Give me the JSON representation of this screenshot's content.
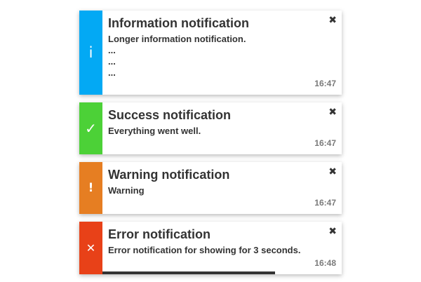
{
  "notifications": [
    {
      "type": "info",
      "color": "#03a9f4",
      "icon": "info-icon",
      "glyph": "i",
      "title": "Information notification",
      "message_lines": [
        "Longer information notification.",
        "...",
        "...",
        "..."
      ],
      "time": "16:47",
      "close_glyph": "✖"
    },
    {
      "type": "success",
      "color": "#4cd137",
      "icon": "checkmark-icon",
      "glyph": "✓",
      "title": "Success notification",
      "message_lines": [
        "Everything went well."
      ],
      "time": "16:47",
      "close_glyph": "✖"
    },
    {
      "type": "warning",
      "color": "#e67e22",
      "icon": "exclamation-icon",
      "glyph": "!",
      "title": "Warning notification",
      "message_lines": [
        "Warning"
      ],
      "time": "16:47",
      "close_glyph": "✖"
    },
    {
      "type": "error",
      "color": "#e84118",
      "icon": "error-x-icon",
      "glyph": "✕",
      "title": "Error notification",
      "message_lines": [
        "Error notification for showing for 3 seconds."
      ],
      "time": "16:48",
      "close_glyph": "✖",
      "progress_fraction": 0.72
    }
  ]
}
